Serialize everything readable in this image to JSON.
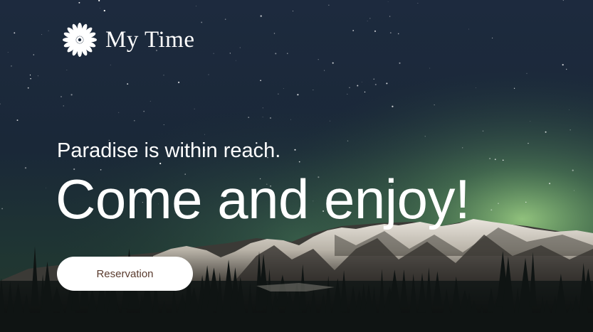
{
  "brand": {
    "name": "My Time",
    "icon": "flower-icon"
  },
  "hero": {
    "tagline": "Paradise is within reach.",
    "headline": "Come and enjoy!",
    "background": "night-sky-mountains-aurora"
  },
  "cta": {
    "label": "Reservation"
  },
  "colors": {
    "text": "#ffffff",
    "button_bg": "#ffffff",
    "button_text": "#5a3b2e",
    "sky": "#1b2a3f",
    "aurora": "#8fd07a"
  }
}
